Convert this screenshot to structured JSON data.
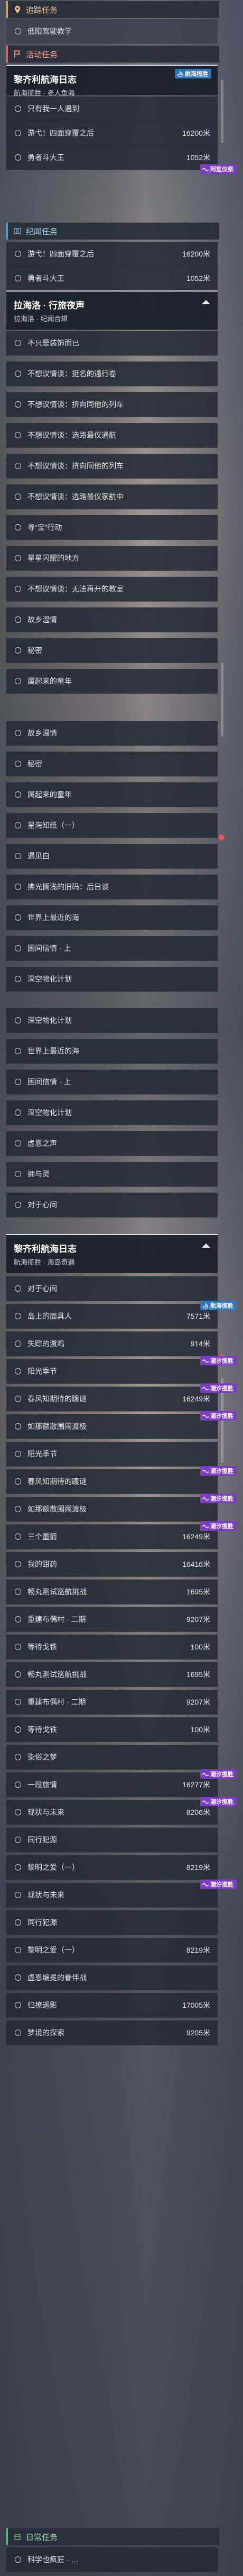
{
  "sections": {
    "trace": "追踪任务",
    "activity": "活动任务",
    "chronicle": "纪闻任务",
    "daily": "日常任务"
  },
  "top_item": "低阻驾驶教学",
  "tag_labels": {
    "voyage": "航海揽胜",
    "tide": "潮汐揽胜",
    "cult": "阿笙仪祭"
  },
  "card1": {
    "title": "黎齐利航海日志",
    "subtitle": "航海揽胜 · 老人鱼海"
  },
  "card2": {
    "title": "拉海洛 · 行旅夜声",
    "subtitle": "拉海洛 · 纪闻合辑"
  },
  "card3": {
    "title": "黎齐利航海日志",
    "subtitle": "航海揽胜 · 海岛奇遇"
  },
  "activity_rows": [
    {
      "label": "只有我一人遇到",
      "dist": ""
    },
    {
      "label": "游弋！四面穿覆之后",
      "dist": "16200米"
    },
    {
      "label": "勇者斗大王",
      "dist": "1052米"
    }
  ],
  "chronicle_peek": [
    {
      "label": "游弋！四面穿覆之后",
      "dist": "16200米"
    },
    {
      "label": "勇者斗大王",
      "dist": "1052米"
    }
  ],
  "chronicle_rows": [
    "不只是装饰而已",
    "不想议情谈：挺名的通行卷",
    "不想议情谈：挤向同他的列车",
    "不想议情谈：选路最仪通航",
    "不想议情谈：挤向同他的列车",
    "不想议情谈：选路最仪家航中",
    "寻“宝”行动",
    "星星闪耀的地方",
    "不想议情谈：无法再开的教室",
    "故乡温情",
    "秘密",
    "属起来的童年"
  ],
  "chronicle_rows2": [
    "故乡温情",
    "秘密",
    "属起来的童年",
    "星海知纸（一）",
    "遇见白",
    "拂光搁浅的旧码：后日谈",
    "世界上最近的海",
    "困间信情 · 上",
    "深空物化计划"
  ],
  "chronicle_rows3": [
    "深空物化计划",
    "世界上最近的海",
    "困间信情 · 上",
    "深空物化计划",
    "虚恩之声",
    "拥与灵",
    "对于心间"
  ],
  "voyage_rows": [
    {
      "label": "对于心间",
      "dist": "",
      "tag": ""
    },
    {
      "label": "岛上的面具人",
      "dist": "7571米",
      "tag": "voyage"
    },
    {
      "label": "失踪的渡鸡",
      "dist": "914米",
      "tag": ""
    },
    {
      "label": "阳光季节",
      "dist": "",
      "tag": "tide"
    },
    {
      "label": "春风知期待的踱谜",
      "dist": "16249米",
      "tag": "tide"
    },
    {
      "label": "如那额散围闹渡极",
      "dist": "",
      "tag": "tide"
    },
    {
      "label": "阳光季节",
      "dist": "",
      "tag": ""
    },
    {
      "label": "春风知期待的踱谜",
      "dist": "",
      "tag": "tide"
    },
    {
      "label": "如那额散围闹渡极",
      "dist": "",
      "tag": "tide"
    },
    {
      "label": "三个墨箭",
      "dist": "16249米",
      "tag": "tide"
    },
    {
      "label": "我的甜药",
      "dist": "16416米",
      "tag": ""
    },
    {
      "label": "畅丸测试巡航挑战",
      "dist": "1695米",
      "tag": ""
    },
    {
      "label": "重建布偶村 · 二期",
      "dist": "9207米",
      "tag": ""
    },
    {
      "label": "等待戈铁",
      "dist": "100米",
      "tag": ""
    },
    {
      "label": "畅丸测试巡航挑战",
      "dist": "1695米",
      "tag": ""
    },
    {
      "label": "重建布偶村 · 二期",
      "dist": "9207米",
      "tag": ""
    },
    {
      "label": "等待戈铁",
      "dist": "100米",
      "tag": ""
    },
    {
      "label": "染俗之梦",
      "dist": "",
      "tag": ""
    },
    {
      "label": "一段旅情",
      "dist": "16277米",
      "tag": "tide"
    },
    {
      "label": "现状与未来",
      "dist": "8206米",
      "tag": "tide"
    },
    {
      "label": "同行犯源",
      "dist": "",
      "tag": ""
    },
    {
      "label": "黎明之爱（一）",
      "dist": "8219米",
      "tag": ""
    },
    {
      "label": "现状与未来",
      "dist": "",
      "tag": "tide"
    },
    {
      "label": "同行犯源",
      "dist": "",
      "tag": ""
    },
    {
      "label": "黎明之爱（一）",
      "dist": "8219米",
      "tag": ""
    },
    {
      "label": "虚恩编冕的眷伴战",
      "dist": "",
      "tag": ""
    },
    {
      "label": "归撩遥影",
      "dist": "17005米",
      "tag": ""
    },
    {
      "label": "梦境的探索",
      "dist": "9205米",
      "tag": ""
    }
  ],
  "daily_rows": [
    "科学也疯狂 · …"
  ]
}
